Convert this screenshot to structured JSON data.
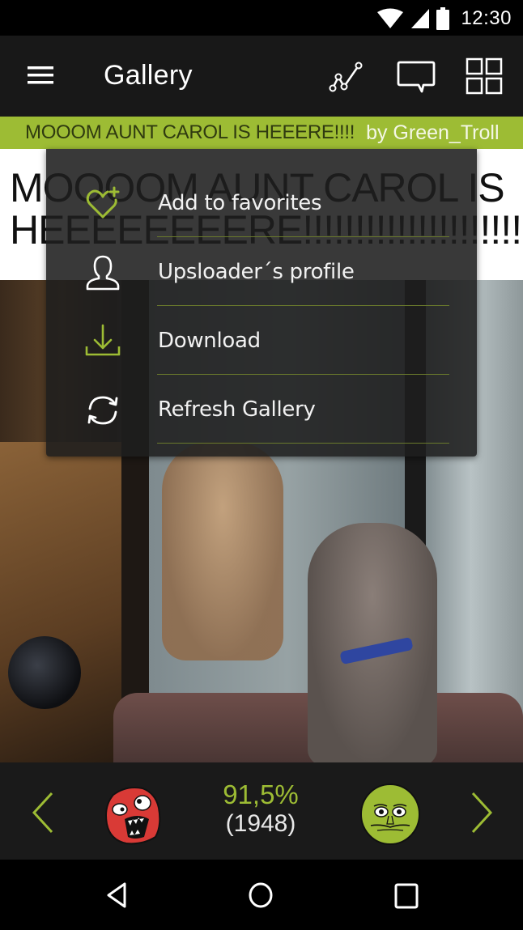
{
  "status_bar": {
    "time": "12:30",
    "icons": [
      "wifi-icon",
      "cell-signal-icon",
      "battery-icon"
    ]
  },
  "app_bar": {
    "title": "Gallery",
    "menu_icon": "hamburger-menu-icon",
    "actions": [
      {
        "name": "stats",
        "icon": "line-chart-icon"
      },
      {
        "name": "comments",
        "icon": "comment-icon"
      },
      {
        "name": "grid-view",
        "icon": "grid-icon"
      }
    ]
  },
  "post": {
    "title": "MOOOM AUNT CAROL IS HEEERE!!!!",
    "author": "by Green_Troll",
    "caption_line1": "MOOOOM AUNT CAROL IS",
    "caption_line2": "HEEEEEEEERE!!!!!!!!!!!!!!!!!!!!!!"
  },
  "popup_menu": {
    "items": [
      {
        "label": "Add to favorites",
        "icon": "heart-plus-icon"
      },
      {
        "label": "Upsloader´s profile",
        "icon": "user-profile-icon"
      },
      {
        "label": "Download",
        "icon": "download-icon"
      },
      {
        "label": "Refresh Gallery",
        "icon": "refresh-icon"
      }
    ]
  },
  "rating": {
    "percent": "91,5%",
    "count": "(1948)",
    "downvote_icon": "rage-face-icon",
    "upvote_icon": "me-gusta-face-icon",
    "prev_icon": "chevron-left-icon",
    "next_icon": "chevron-right-icon"
  },
  "nav_bar": {
    "buttons": [
      "back-icon",
      "home-icon",
      "recents-icon"
    ]
  },
  "colors": {
    "accent": "#9dbc34",
    "app_bar_bg": "#181818",
    "popup_bg": "#1e1e1e",
    "downvote_face": "#d93a36"
  }
}
